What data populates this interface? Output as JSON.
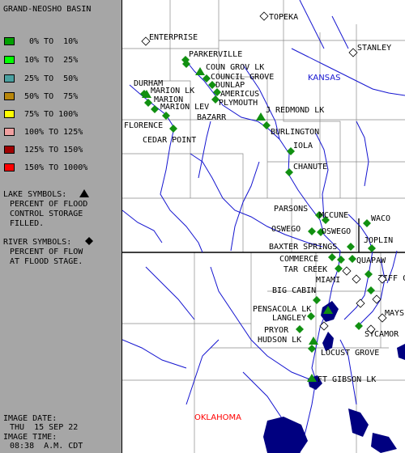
{
  "legend": {
    "title": "GRAND-NEOSHO BASIN",
    "ranges": [
      {
        "label": "0% TO  10%",
        "color": "#00a000"
      },
      {
        "label": "10% TO  25%",
        "color": "#00ff00"
      },
      {
        "label": "25% TO  50%",
        "color": "#4aa0a0"
      },
      {
        "label": "50% TO  75%",
        "color": "#b8860b"
      },
      {
        "label": "75% TO 100%",
        "color": "#ffff00"
      },
      {
        "label": "100% TO 125%",
        "color": "#f0a0a0"
      },
      {
        "label": "125% TO 150%",
        "color": "#a00000"
      },
      {
        "label": "150% TO 1000%",
        "color": "#ff0000"
      }
    ],
    "lake_symbols": [
      "LAKE SYMBOLS:",
      "PERCENT OF FLOOD",
      "CONTROL STORAGE",
      "FILLED."
    ],
    "river_symbols": [
      "RIVER SYMBOLS:",
      "PERCENT OF FLOW",
      "AT FLOOD STAGE."
    ],
    "image_date_label": "IMAGE DATE:",
    "image_date": "THU  15 SEP 22",
    "image_time_label": "IMAGE TIME:",
    "image_time": "08:38  A.M. CDT"
  },
  "states": {
    "kansas": "KANSAS",
    "oklahoma": "OKLAHOMA"
  },
  "stations": [
    {
      "name": "TOPEKA",
      "kind": "city"
    },
    {
      "name": "STANLEY",
      "kind": "city"
    },
    {
      "name": "ENTERPRISE",
      "kind": "city"
    },
    {
      "name": "PARKERVILLE",
      "kind": "river"
    },
    {
      "name": "COUN GROV LK",
      "kind": "lake"
    },
    {
      "name": "COUNCIL GROVE",
      "kind": "river"
    },
    {
      "name": "DUNLAP",
      "kind": "river"
    },
    {
      "name": "AMERICUS",
      "kind": "river"
    },
    {
      "name": "PLYMOUTH",
      "kind": "river"
    },
    {
      "name": "DURHAM",
      "kind": "river"
    },
    {
      "name": "MARION LK",
      "kind": "lake"
    },
    {
      "name": "MARION",
      "kind": "river"
    },
    {
      "name": "MARION LEV",
      "kind": "river"
    },
    {
      "name": "BAZARR",
      "kind": "river"
    },
    {
      "name": "FLORENCE",
      "kind": "river"
    },
    {
      "name": "CEDAR POINT",
      "kind": "river"
    },
    {
      "name": "J REDMOND LK",
      "kind": "lake"
    },
    {
      "name": "BURLINGTON",
      "kind": "river"
    },
    {
      "name": "IOLA",
      "kind": "river"
    },
    {
      "name": "CHANUTE",
      "kind": "river"
    },
    {
      "name": "PARSONS",
      "kind": "river"
    },
    {
      "name": "MCCUNE",
      "kind": "river"
    },
    {
      "name": "OSWEGO",
      "kind": "river"
    },
    {
      "name": "OSWEGO",
      "kind": "river"
    },
    {
      "name": "WACO",
      "kind": "river"
    },
    {
      "name": "JOPLIN",
      "kind": "river"
    },
    {
      "name": "BAXTER SPRINGS",
      "kind": "river"
    },
    {
      "name": "COMMERCE",
      "kind": "river"
    },
    {
      "name": "QUAPAW",
      "kind": "river"
    },
    {
      "name": "TAR CREEK",
      "kind": "river"
    },
    {
      "name": "MIAMI",
      "kind": "river"
    },
    {
      "name": "TIFF CI",
      "kind": "river"
    },
    {
      "name": "BIG CABIN",
      "kind": "river"
    },
    {
      "name": "PENSACOLA LK",
      "kind": "lake"
    },
    {
      "name": "LANGLEY",
      "kind": "river"
    },
    {
      "name": "MAYS",
      "kind": "river"
    },
    {
      "name": "PRYOR",
      "kind": "river"
    },
    {
      "name": "SYCAMOR",
      "kind": "river"
    },
    {
      "name": "HUDSON LK",
      "kind": "lake"
    },
    {
      "name": "LOCUST GROVE",
      "kind": "river"
    },
    {
      "name": "FT GIBSON LK",
      "kind": "lake"
    }
  ],
  "colors": {
    "station": "#119011",
    "river": "#1515d0",
    "county": "#8a8a8a",
    "state_line": "#000000",
    "legend_bg": "#a6a6a6"
  }
}
